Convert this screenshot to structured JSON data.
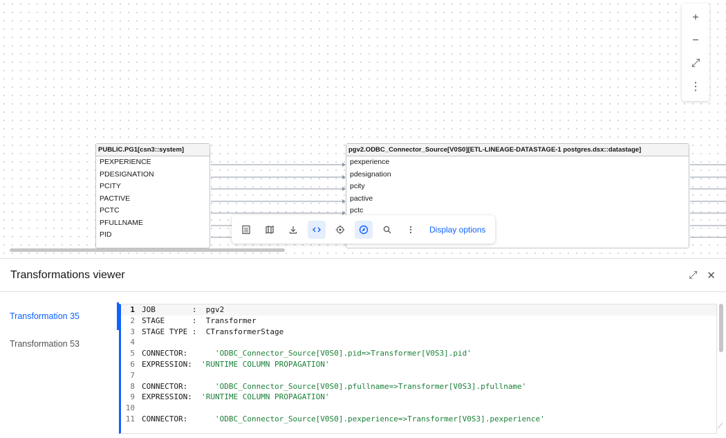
{
  "canvas": {
    "zoom_controls": [
      {
        "name": "zoom-in-button",
        "icon": "plus-icon",
        "glyph": "+"
      },
      {
        "name": "zoom-out-button",
        "icon": "minus-icon",
        "glyph": "−"
      },
      {
        "name": "fit-view-button",
        "icon": "expand-icon",
        "glyph": "⤢"
      },
      {
        "name": "more-options-button",
        "icon": "overflow-menu-icon",
        "glyph": "⋮"
      }
    ],
    "source_node": {
      "title": "PUBLIC.PG1[csn3::system]",
      "fields": [
        "PEXPERIENCE",
        "PDESIGNATION",
        "PCITY",
        "PACTIVE",
        "PCTC",
        "PFULLNAME",
        "PID"
      ]
    },
    "target_node": {
      "title": "pgv2.ODBC_Connector_Source[V0S0][ETL-LINEAGE-DATASTAGE-1 postgres.dsx::datastage]",
      "fields": [
        "pexperience",
        "pdesignation",
        "pcity",
        "pactive",
        "pctc"
      ]
    },
    "toolbar": {
      "buttons": [
        {
          "name": "table-view-button",
          "icon": "table-icon"
        },
        {
          "name": "map-button",
          "icon": "map-icon"
        },
        {
          "name": "download-button",
          "icon": "download-icon"
        },
        {
          "name": "code-view-button",
          "icon": "code-icon",
          "active": true
        },
        {
          "name": "focus-button",
          "icon": "target-icon"
        },
        {
          "name": "navigate-button",
          "icon": "compass-icon",
          "active": true
        },
        {
          "name": "search-button",
          "icon": "search-icon"
        },
        {
          "name": "toolbar-more-button",
          "icon": "overflow-menu-icon"
        }
      ],
      "display_options_label": "Display options"
    }
  },
  "viewer": {
    "title": "Transformations viewer",
    "transformations": [
      {
        "label": "Transformation 35",
        "active": true
      },
      {
        "label": "Transformation 53",
        "active": false
      }
    ],
    "code_lines": [
      {
        "n": "1",
        "plain": "JOB        :  pgv2",
        "str": ""
      },
      {
        "n": "2",
        "plain": "STAGE      :  Transformer",
        "str": ""
      },
      {
        "n": "3",
        "plain": "STAGE TYPE :  CTransformerStage",
        "str": ""
      },
      {
        "n": "4",
        "plain": "",
        "str": ""
      },
      {
        "n": "5",
        "plain": "CONNECTOR:      ",
        "str": "'ODBC_Connector_Source[V0S0].pid=>Transformer[V0S3].pid'"
      },
      {
        "n": "6",
        "plain": "EXPRESSION:  ",
        "str": "'RUNTIME COLUMN PROPAGATION'"
      },
      {
        "n": "7",
        "plain": "",
        "str": ""
      },
      {
        "n": "8",
        "plain": "CONNECTOR:      ",
        "str": "'ODBC_Connector_Source[V0S0].pfullname=>Transformer[V0S3].pfullname'"
      },
      {
        "n": "9",
        "plain": "EXPRESSION:  ",
        "str": "'RUNTIME COLUMN PROPAGATION'"
      },
      {
        "n": "10",
        "plain": "",
        "str": ""
      },
      {
        "n": "11",
        "plain": "CONNECTOR:      ",
        "str": "'ODBC_Connector_Source[V0S0].pexperience=>Transformer[V0S3].pexperience'"
      }
    ]
  }
}
